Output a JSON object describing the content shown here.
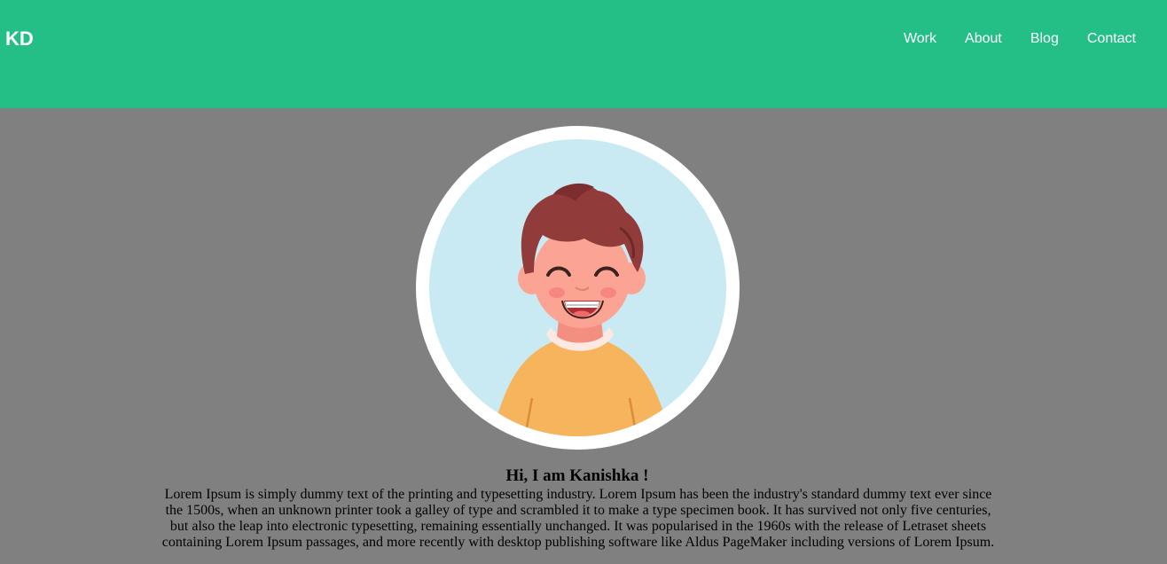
{
  "brand": "KD",
  "nav": {
    "work": "Work",
    "about": "About",
    "blog": "Blog",
    "contact": "Contact"
  },
  "hero": {
    "greeting": "Hi, I am Kanishka !",
    "bio": "Lorem Ipsum is simply dummy text of the printing and typesetting industry. Lorem Ipsum has been the industry's standard dummy text ever since the 1500s, when an unknown printer took a galley of type and scrambled it to make a type specimen book. It has survived not only five centuries, but also the leap into electronic typesetting, remaining essentially unchanged. It was popularised in the 1960s with the release of Letraset sheets containing Lorem Ipsum passages, and more recently with desktop publishing software like Aldus PageMaker including versions of Lorem Ipsum."
  },
  "colors": {
    "navbar": "#24be87",
    "page_background": "#808080",
    "avatar_background": "#c9eaf3",
    "shirt": "#f6b45c",
    "hair": "#913c3a",
    "skin": "#fca493"
  }
}
